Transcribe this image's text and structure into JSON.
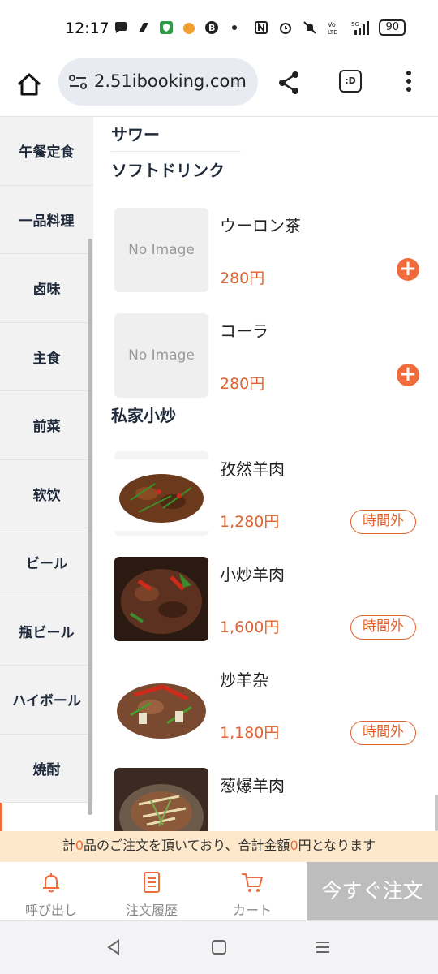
{
  "status_bar": {
    "time": "12:17",
    "battery": "90",
    "network": "5G"
  },
  "browser": {
    "url": "2.51ibooking.com",
    "tab_label": ":D"
  },
  "sidebar": {
    "items": [
      {
        "label": "午餐定食"
      },
      {
        "label": "一品料理"
      },
      {
        "label": "卤味"
      },
      {
        "label": "主食"
      },
      {
        "label": "前菜"
      },
      {
        "label": "软饮"
      },
      {
        "label": "ビール"
      },
      {
        "label": "瓶ビール"
      },
      {
        "label": "ハイボール"
      },
      {
        "label": "焼酎"
      }
    ]
  },
  "content": {
    "categories": [
      {
        "title": "サワー"
      },
      {
        "title": "ソフトドリンク"
      },
      {
        "title": "私家小炒"
      }
    ],
    "no_image_text": "No Image",
    "items": [
      {
        "name": "ウーロン茶",
        "price": "280円",
        "action": "+"
      },
      {
        "name": "コーラ",
        "price": "280円",
        "action": "+"
      },
      {
        "name": "孜然羊肉",
        "price": "1,280円",
        "badge": "時間外"
      },
      {
        "name": "小炒羊肉",
        "price": "1,600円",
        "badge": "時間外"
      },
      {
        "name": "炒羊杂",
        "price": "1,180円",
        "badge": "時間外"
      },
      {
        "name": "葱爆羊肉",
        "price": "",
        "badge": ""
      }
    ]
  },
  "notice": {
    "prefix": "計",
    "count": "0",
    "middle": "品のご注文を頂いており、合計金額",
    "amount": "0",
    "suffix": "円となります"
  },
  "bottom_nav": {
    "call": "呼び出し",
    "history": "注文履歴",
    "cart": "カート",
    "order_now": "今すぐ注文"
  },
  "colors": {
    "accent": "#ef6b3b",
    "price": "#e0622e",
    "notice_bg": "#fde8cb"
  }
}
